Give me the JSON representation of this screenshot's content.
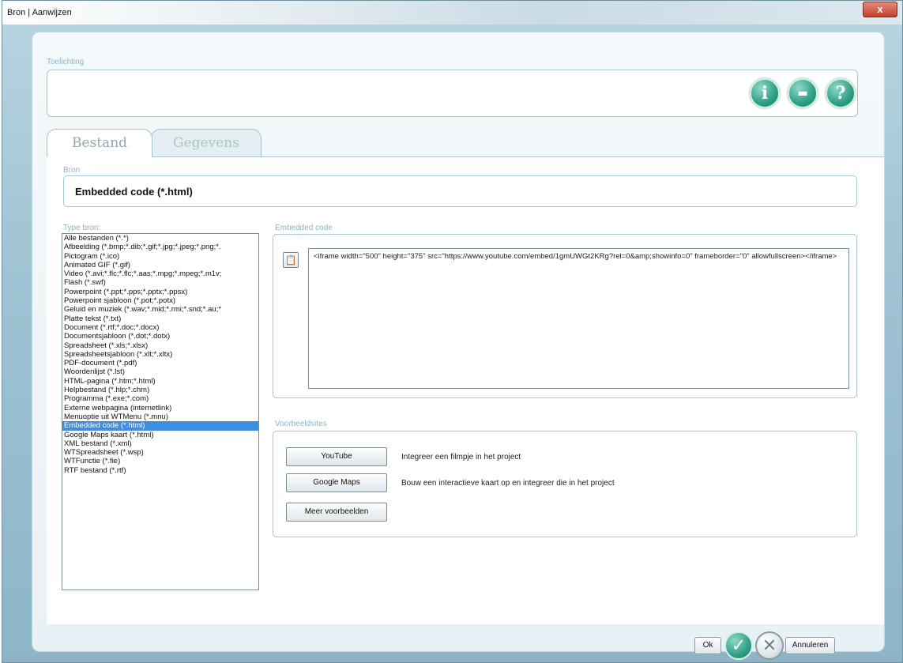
{
  "window": {
    "title": "Bron | Aanwijzen",
    "close_glyph": "x"
  },
  "toelichting": {
    "label": "Toelichting"
  },
  "header_icons": [
    {
      "name": "info-icon",
      "glyph": "i"
    },
    {
      "name": "video-icon",
      "glyph": "▬"
    },
    {
      "name": "help-icon",
      "glyph": "?"
    }
  ],
  "tabs": {
    "active": "Bestand",
    "inactive": "Gegevens"
  },
  "bron": {
    "label": "Bron",
    "value": "Embedded code (*.html)"
  },
  "type_bron": {
    "label": "Type bron:",
    "items": [
      "Alle bestanden (*.*)",
      "Afbeelding (*.bmp;*.dib;*.gif;*.jpg;*.jpeg;*.png;*.",
      "Pictogram (*.ico)",
      "Animated GIF (*.gif)",
      "Video (*.avi;*.flc;*.flc;*.aas;*.mpg;*.mpeg;*.m1v;",
      "Flash (*.swf)",
      "Powerpoint (*.ppt;*.pps;*.pptx;*.ppsx)",
      "Powerpoint sjabloon (*.pot;*.potx)",
      "Geluid en muziek (*.wav;*.mid;*.rmi;*.snd;*.au;*",
      "Platte tekst (*.txt)",
      "Document (*.rtf;*.doc;*.docx)",
      "Documentsjabloon (*.dot;*.dotx)",
      "Spreadsheet (*.xls;*.xlsx)",
      "Spreadsheetsjabloon (*.xlt;*.xltx)",
      "PDF-document (*.pdf)",
      "Woordenlijst (*.lst)",
      "HTML-pagina (*.htm;*.html)",
      "Helpbestand (*.hlp;*.chm)",
      "Programma (*.exe;*.com)",
      "Externe webpagina (internetlink)",
      "Menuoptie uit WTMenu (*.mnu)",
      "Embedded code (*.html)",
      "Google Maps kaart (*.html)",
      "XML bestand (*.xml)",
      "WTSpreadsheet (*.wsp)",
      "WTFunctie (*.fie)",
      "RTF bestand (*.rtf)"
    ],
    "selected_index": 21
  },
  "embedded_code": {
    "label": "Embedded code",
    "value": "<iframe width=\"500\" height=\"375\" src=\"https://www.youtube.com/embed/1gmUWGt2KRg?rel=0&amp;showinfo=0\" frameborder=\"0\" allowfullscreen></iframe>"
  },
  "voorbeeldsites": {
    "label": "Voorbeeldsites",
    "items": [
      {
        "button": "YouTube",
        "description": "Integreer een filmpje in het project"
      },
      {
        "button": "Google Maps",
        "description": "Bouw een interactieve kaart op en integreer die in het project"
      },
      {
        "button": "Meer voorbeelden",
        "description": ""
      }
    ]
  },
  "footer": {
    "ok": "Ok",
    "ok_icon": "✓",
    "cancel_icon": "✕",
    "cancel": "Annuleren"
  },
  "colors": {
    "accent": "#2e9f86",
    "selection": "#3c8ee3",
    "border": "#a7c4d2"
  }
}
